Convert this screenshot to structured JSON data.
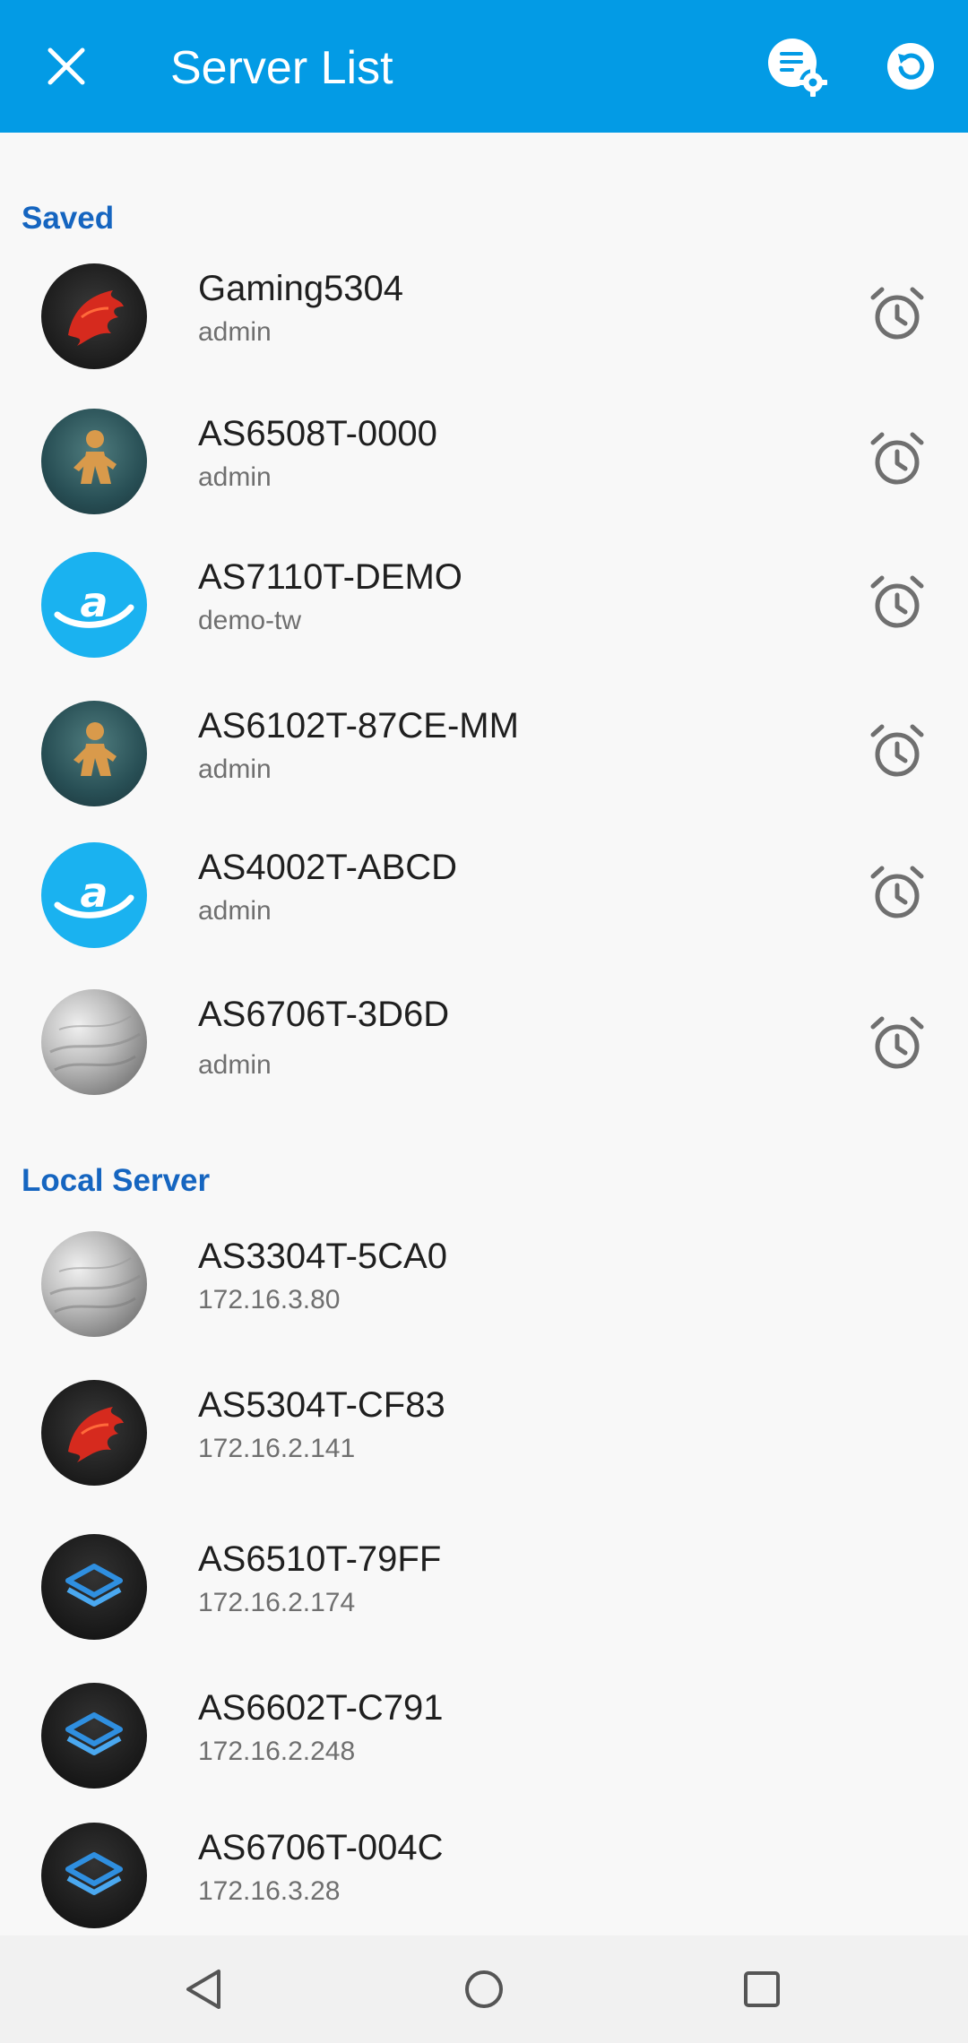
{
  "header": {
    "title": "Server List",
    "close_icon": "close-icon",
    "manage_icon": "list-settings-icon",
    "refresh_icon": "refresh-icon",
    "background": "#039be5"
  },
  "sections": {
    "saved": {
      "label": "Saved",
      "items": [
        {
          "name": "Gaming5304",
          "sub": "admin",
          "avatar": "dragon"
        },
        {
          "name": "AS6508T-0000",
          "sub": "admin",
          "avatar": "figure"
        },
        {
          "name": "AS7110T-DEMO",
          "sub": "demo-tw",
          "avatar": "asus-a"
        },
        {
          "name": "AS6102T-87CE-MM",
          "sub": "admin",
          "avatar": "figure"
        },
        {
          "name": "AS4002T-ABCD",
          "sub": "admin",
          "avatar": "asus-a"
        },
        {
          "name": "AS6706T-3D6D",
          "sub": "admin",
          "avatar": "marble"
        }
      ]
    },
    "local": {
      "label": "Local Server",
      "items": [
        {
          "name": "AS3304T-5CA0",
          "sub": "172.16.3.80",
          "avatar": "marble"
        },
        {
          "name": "AS5304T-CF83",
          "sub": "172.16.2.141",
          "avatar": "dragon"
        },
        {
          "name": "AS6510T-79FF",
          "sub": "172.16.2.174",
          "avatar": "layers"
        },
        {
          "name": "AS6602T-C791",
          "sub": "172.16.2.248",
          "avatar": "layers"
        },
        {
          "name": "AS6706T-004C",
          "sub": "172.16.3.28",
          "avatar": "layers"
        }
      ]
    }
  },
  "navbar": {
    "back_icon": "back-triangle-icon",
    "home_icon": "home-circle-icon",
    "recents_icon": "recents-square-icon"
  },
  "colors": {
    "section_header": "#1565c0",
    "alarm_icon": "#6f6f6f"
  }
}
